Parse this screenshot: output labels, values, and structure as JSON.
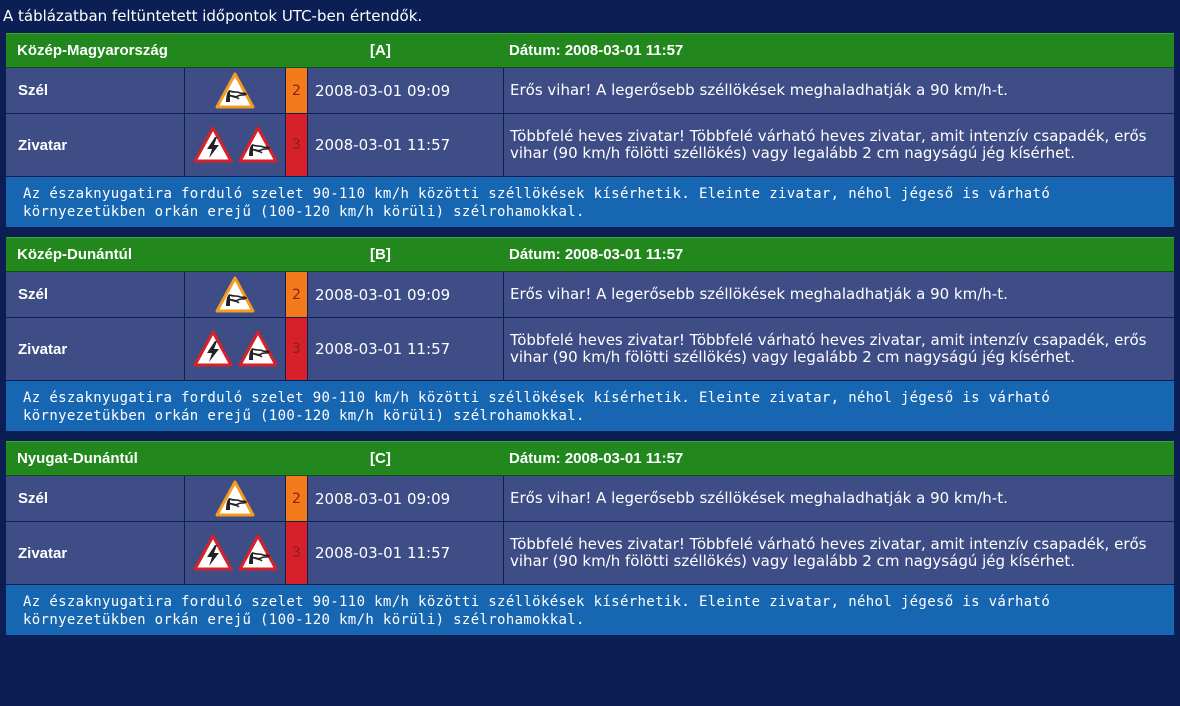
{
  "note": "A táblázatban feltüntetett időpontok UTC-ben értendők.",
  "colors": {
    "background": "#0b1f55",
    "header": "#22881e",
    "row": "#3e4d86",
    "remark": "#1766b2",
    "level2": "#f47b1b",
    "level3": "#d6212a"
  },
  "regions": [
    {
      "name": "Közép-Magyarország",
      "code": "[A]",
      "date": "Dátum: 2008-03-01 11:57",
      "rows": [
        {
          "type": "Szél",
          "icons": [
            "wind-warning-icon"
          ],
          "level": "2",
          "time": "2008-03-01 09:09",
          "desc": "Erős vihar! A legerősebb széllökések meghaladhatják a 90 km/h-t."
        },
        {
          "type": "Zivatar",
          "icons": [
            "thunderstorm-warning-icon",
            "wind-warning-icon"
          ],
          "level": "3",
          "time": "2008-03-01 11:57",
          "desc": "Többfelé heves zivatar! Többfelé várható heves zivatar, amit intenzív csapadék, erős vihar (90 km/h fölötti széllökés) vagy legalább 2 cm nagyságú jég kísérhet."
        }
      ],
      "remark": "Az északnyugatira forduló szelet 90-110 km/h közötti széllökések kísérhetik. Eleinte zivatar, néhol jégeső is várható környezetükben orkán erejű (100-120 km/h körüli) szélrohamokkal."
    },
    {
      "name": "Közép-Dunántúl",
      "code": "[B]",
      "date": "Dátum: 2008-03-01 11:57",
      "rows": [
        {
          "type": "Szél",
          "icons": [
            "wind-warning-icon"
          ],
          "level": "2",
          "time": "2008-03-01 09:09",
          "desc": "Erős vihar! A legerősebb széllökések meghaladhatják a 90 km/h-t."
        },
        {
          "type": "Zivatar",
          "icons": [
            "thunderstorm-warning-icon",
            "wind-warning-icon"
          ],
          "level": "3",
          "time": "2008-03-01 11:57",
          "desc": "Többfelé heves zivatar! Többfelé várható heves zivatar, amit intenzív csapadék, erős vihar (90 km/h fölötti széllökés) vagy legalább 2 cm nagyságú jég kísérhet."
        }
      ],
      "remark": "Az északnyugatira forduló szelet 90-110 km/h közötti széllökések kísérhetik. Eleinte zivatar, néhol jégeső is várható környezetükben orkán erejű (100-120 km/h körüli) szélrohamokkal."
    },
    {
      "name": "Nyugat-Dunántúl",
      "code": "[C]",
      "date": "Dátum: 2008-03-01 11:57",
      "rows": [
        {
          "type": "Szél",
          "icons": [
            "wind-warning-icon"
          ],
          "level": "2",
          "time": "2008-03-01 09:09",
          "desc": "Erős vihar! A legerősebb széllökések meghaladhatják a 90 km/h-t."
        },
        {
          "type": "Zivatar",
          "icons": [
            "thunderstorm-warning-icon",
            "wind-warning-icon"
          ],
          "level": "3",
          "time": "2008-03-01 11:57",
          "desc": "Többfelé heves zivatar! Többfelé várható heves zivatar, amit intenzív csapadék, erős vihar (90 km/h fölötti széllökés) vagy legalább 2 cm nagyságú jég kísérhet."
        }
      ],
      "remark": "Az északnyugatira forduló szelet 90-110 km/h közötti széllökések kísérhetik. Eleinte zivatar, néhol jégeső is várható környezetükben orkán erejű (100-120 km/h körüli) szélrohamokkal."
    }
  ]
}
